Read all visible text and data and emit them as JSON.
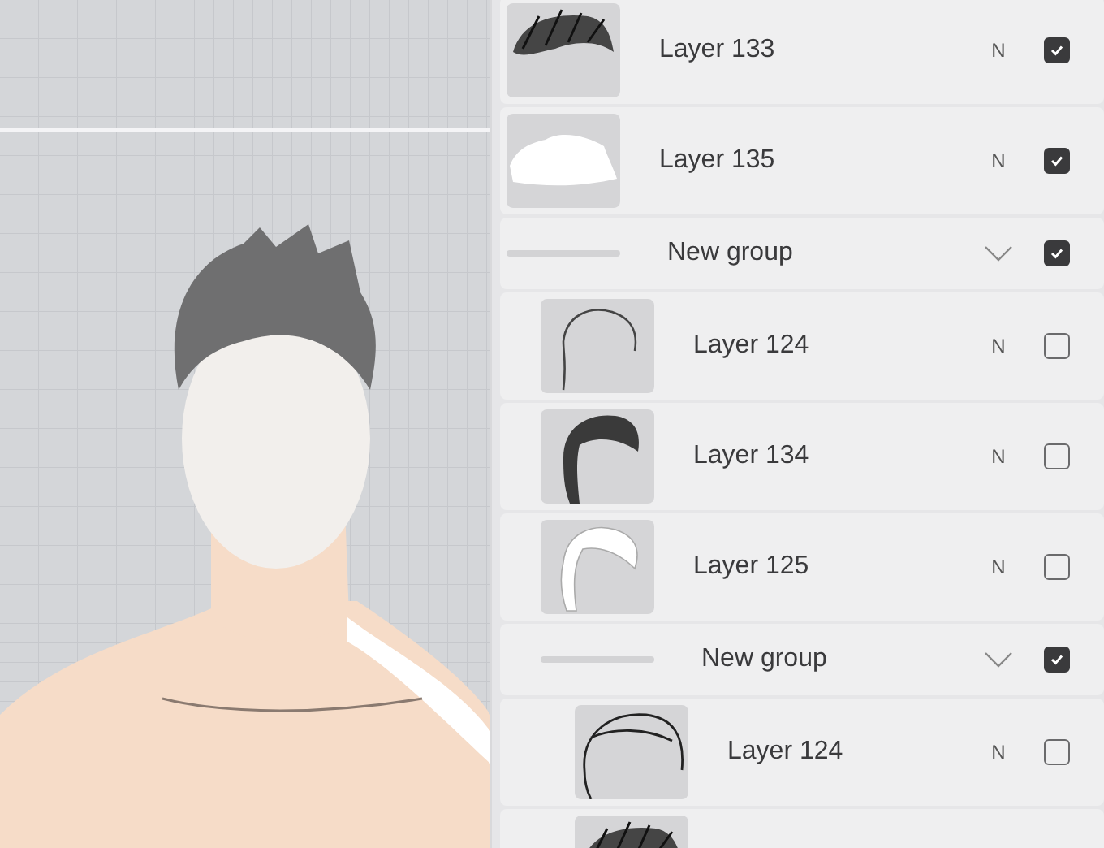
{
  "layers": [
    {
      "kind": "layer",
      "name": "Layer 133",
      "blend": "N",
      "visible": true
    },
    {
      "kind": "layer",
      "name": "Layer 135",
      "blend": "N",
      "visible": true
    },
    {
      "kind": "group",
      "name": "New group",
      "expanded": true,
      "visible": true,
      "children": [
        {
          "kind": "layer",
          "name": "Layer 124",
          "blend": "N",
          "visible": false
        },
        {
          "kind": "layer",
          "name": "Layer 134",
          "blend": "N",
          "visible": false
        },
        {
          "kind": "layer",
          "name": "Layer 125",
          "blend": "N",
          "visible": false
        },
        {
          "kind": "group",
          "name": "New group",
          "expanded": true,
          "visible": true,
          "children": [
            {
              "kind": "layer",
              "name": "Layer 124",
              "blend": "N",
              "visible": false
            },
            {
              "kind": "layer"
            }
          ]
        }
      ]
    }
  ]
}
